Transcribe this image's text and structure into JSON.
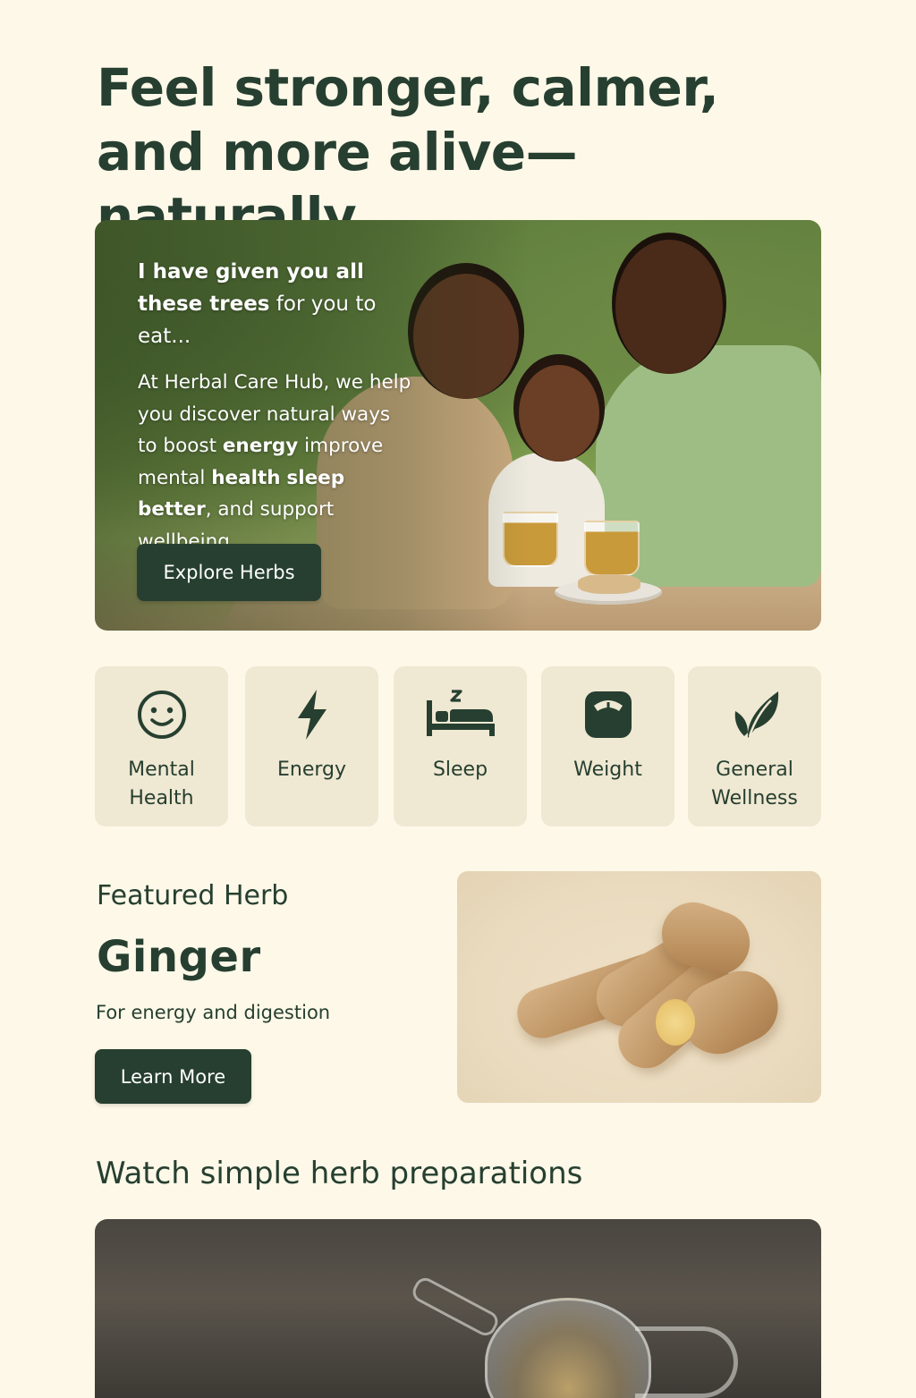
{
  "headline": {
    "line1": "Feel stronger, calmer,",
    "line2": "and more alive—naturally"
  },
  "hero": {
    "verse_bold": "I have given you all these trees",
    "verse_rest": " for you to eat...",
    "body_1": "At Herbal Care Hub, we help you discover natural ways to boost ",
    "body_energy": "energy",
    "body_2": " improve mental ",
    "body_health": "health",
    "body_3": " ",
    "body_sleep": "sleep better",
    "body_4": ", and support wellbeing.",
    "button_label": "Explore Herbs"
  },
  "categories": [
    {
      "label": "Mental\nHealth",
      "icon": "smiley-face-icon"
    },
    {
      "label": "Energy",
      "icon": "lightning-bolt-icon"
    },
    {
      "label": "Sleep",
      "icon": "bed-icon"
    },
    {
      "label": "Weight",
      "icon": "scale-icon"
    },
    {
      "label": "General\nWellness",
      "icon": "leaf-icon"
    }
  ],
  "featured": {
    "kicker": "Featured Herb",
    "name": "Ginger",
    "description": "For energy and digestion",
    "button_label": "Learn More"
  },
  "watch": {
    "title": "Watch simple herb preparations"
  },
  "colors": {
    "background": "#fdf8e8",
    "primary_dark_green": "#263f30",
    "card_beige": "#efe8d2",
    "button_text": "#ffffff"
  }
}
